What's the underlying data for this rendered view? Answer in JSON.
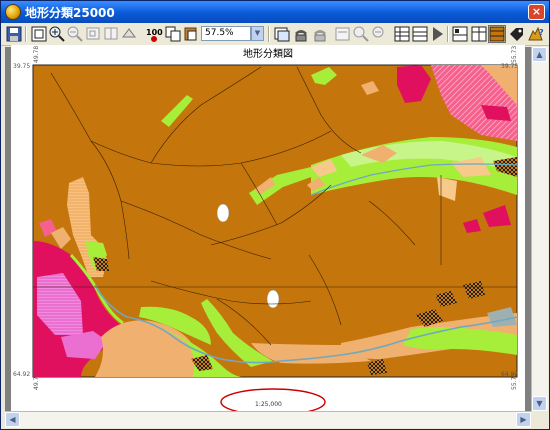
{
  "window": {
    "title": "地形分類25000",
    "close_label": "×"
  },
  "toolbar": {
    "zoom_value": "57.5%",
    "zoom_100_label": "100",
    "icons": [
      "save-icon",
      "fit-icon",
      "zoom-in-icon",
      "zoom-out-icon",
      "zoom-window-icon",
      "zoom-prev-icon",
      "zoom-next-icon",
      "zoom-100-icon",
      "copy-icon",
      "paste-icon",
      "layer-icon",
      "phone-icon",
      "phone2-icon",
      "layer-edit-icon",
      "zoom-in2-icon",
      "zoom-out2-icon",
      "table-icon",
      "table2-icon",
      "table3-icon",
      "arrow-right-icon",
      "table4-icon",
      "table5-icon",
      "map-view-icon",
      "tag-icon",
      "help-icon"
    ]
  },
  "map": {
    "title": "地形分類図",
    "scale_label": "1:25,000",
    "coords": {
      "top_left_h": "39.75",
      "top_left_v": "49.78",
      "top_right_h": "39.75",
      "top_right_v": "55.73",
      "bottom_left_h": "64.92",
      "bottom_left_v": "49.78",
      "bottom_right_h": "64.92",
      "bottom_right_v": "55.73"
    },
    "colors": {
      "base": "#c4750b",
      "green": "#a6ee3a",
      "magenta": "#e0105e",
      "pink": "#ef6fb0",
      "tan": "#f0b070",
      "light_tan": "#f7c98a",
      "light_green": "#c8f58a",
      "gray_blue": "#9fb0b0",
      "annotation": "#cc0000"
    }
  }
}
